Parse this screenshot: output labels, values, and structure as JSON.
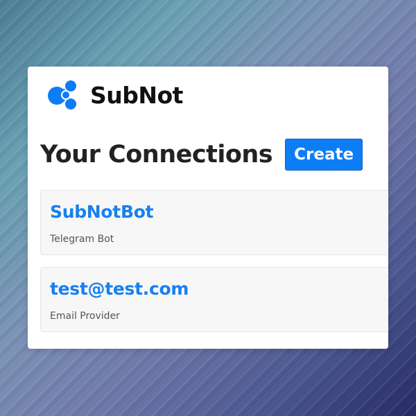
{
  "app": {
    "name": "SubNot",
    "accent_color": "#0d7df5",
    "logo_icon": "connected-circles-icon"
  },
  "page": {
    "title": "Your Connections"
  },
  "actions": {
    "create_label": "Create"
  },
  "connections": [
    {
      "name": "SubNotBot",
      "type": "Telegram Bot"
    },
    {
      "name": "test@test.com",
      "type": "Email Provider"
    }
  ]
}
